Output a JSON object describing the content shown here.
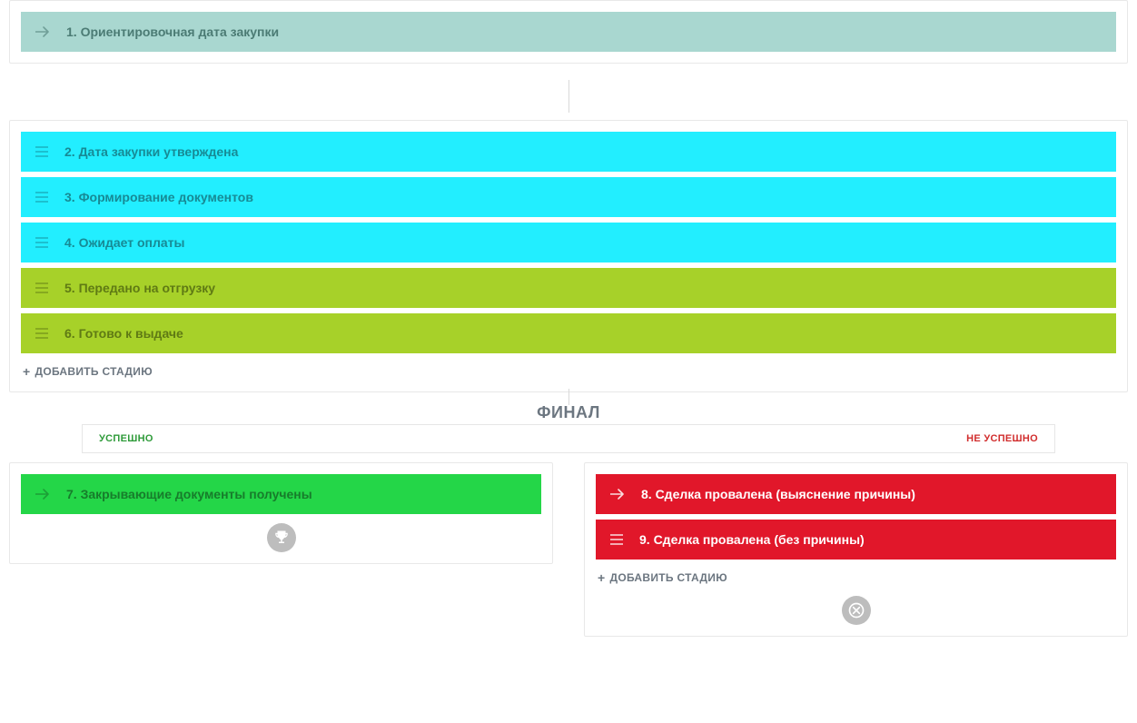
{
  "stage1": {
    "label": "1. Ориентировочная дата закупки"
  },
  "middle": {
    "items": [
      {
        "label": "2. Дата закупки утверждена",
        "tone": "cyan"
      },
      {
        "label": "3. Формирование документов",
        "tone": "cyan"
      },
      {
        "label": "4. Ожидает оплаты",
        "tone": "cyan"
      },
      {
        "label": "5. Передано на отгрузку",
        "tone": "lime"
      },
      {
        "label": "6. Готово к выдаче",
        "tone": "lime"
      }
    ],
    "add_label": "ДОБАВИТЬ СТАДИЮ"
  },
  "final": {
    "title": "ФИНАЛ",
    "tab_success": "УСПЕШНО",
    "tab_fail": "НЕ УСПЕШНО"
  },
  "success": {
    "items": [
      {
        "label": "7. Закрывающие документы получены"
      }
    ]
  },
  "fail": {
    "items": [
      {
        "label": "8. Сделка провалена (выяснение причины)"
      },
      {
        "label": "9. Сделка провалена (без причины)"
      }
    ],
    "add_label": "ДОБАВИТЬ СТАДИЮ"
  }
}
